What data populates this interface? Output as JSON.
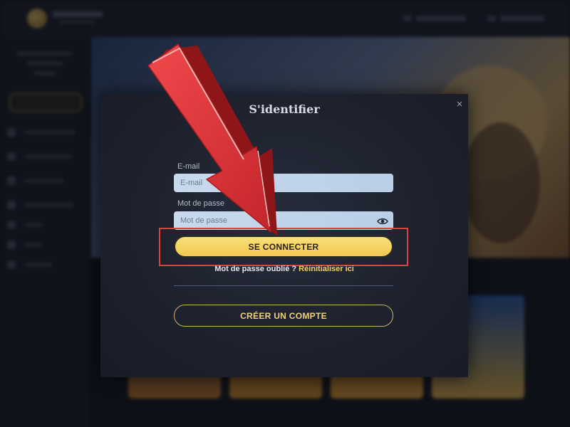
{
  "modal": {
    "title": "S'identifier",
    "close_label": "×",
    "email": {
      "label": "E-mail",
      "placeholder": "E-mail",
      "value": ""
    },
    "password": {
      "label": "Mot de passe",
      "placeholder": "Mot de passe",
      "value": ""
    },
    "login_button": "SE CONNECTER",
    "forgot_text": "Mot de passe oublié ?",
    "forgot_link": "Réinitialiser ici",
    "create_account_button": "CRÉER UN COMPTE"
  },
  "annotation": {
    "arrow_color": "#e2363a",
    "highlight_color": "#d8453e",
    "highlight_target": "SE CONNECTER"
  },
  "colors": {
    "accent_gold": "#f4d162",
    "modal_bg": "#1f2330",
    "field_bg": "#c2d5ea"
  }
}
